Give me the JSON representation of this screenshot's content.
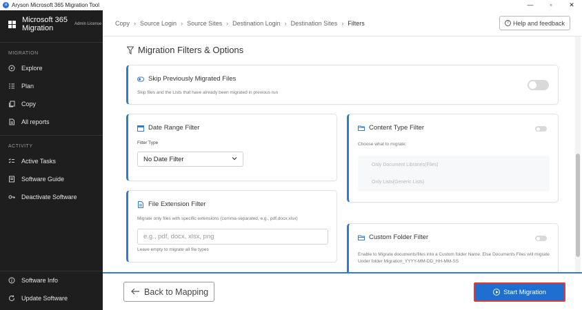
{
  "window": {
    "title": "Aryson Microsoft 365 Migration Tool",
    "controls": [
      "—",
      "▫",
      "✕"
    ]
  },
  "sidebar": {
    "brand_name": "Microsoft 365 Migration",
    "brand_sub": "Admin License",
    "migration_label": "MIGRATION",
    "migration_items": [
      {
        "label": "Explore",
        "icon": "explore-icon"
      },
      {
        "label": "Plan",
        "icon": "plan-icon"
      },
      {
        "label": "Copy",
        "icon": "copy-icon"
      },
      {
        "label": "All reports",
        "icon": "reports-icon"
      }
    ],
    "activity_label": "ACTIVITY",
    "activity_items": [
      {
        "label": "Active Tasks",
        "icon": "tasks-icon"
      },
      {
        "label": "Software Guide",
        "icon": "guide-icon"
      },
      {
        "label": "Deactivate Software",
        "icon": "key-icon"
      }
    ],
    "bottom_items": [
      {
        "label": "Software Info",
        "icon": "info-icon"
      },
      {
        "label": "Update Software",
        "icon": "update-icon"
      }
    ]
  },
  "header": {
    "breadcrumb": [
      "Copy",
      "Source Login",
      "Source Sites",
      "Destination Login",
      "Destination Sites",
      "Filters"
    ],
    "help_label": "Help and feedback"
  },
  "main": {
    "title": "Migration Filters & Options",
    "skip": {
      "title": "Skip Previously Migrated Files",
      "desc": "Skip files and the Lists that have already been migrated in previous run",
      "enabled": false
    },
    "date_range": {
      "title": "Date Range Filter",
      "filter_type_label": "Filter Type",
      "selected": "No Date Filter"
    },
    "content_type": {
      "title": "Content Type Filter",
      "desc": "Choose what to migrate:",
      "options": [
        "Only Document Libraries(Files)",
        "Only Lists(Generic Lists)"
      ],
      "enabled": false
    },
    "file_extension": {
      "title": "File Extension Filter",
      "desc": "Migrate only files with specific extensions (comma-separated, e.g., pdf,docx,xlsx)",
      "placeholder": "e.g., pdf, docx, xlsx, png",
      "hint": "Leave empty to migrate all file types"
    },
    "custom_folder": {
      "title": "Custom Folder Filter",
      "desc": "Enable to Migrate documents/files into a Custom folder Name. Else Documents Files will migrate Under folder Migration_YYYY-MM-DD_HH-MM-SS",
      "enabled": false
    }
  },
  "footer": {
    "back_label": "Back to Mapping",
    "start_label": "Start Migration"
  },
  "colors": {
    "accent": "#2e7bd6",
    "sidebar_bg": "#1e1e1e",
    "highlight_border": "#e23838"
  }
}
